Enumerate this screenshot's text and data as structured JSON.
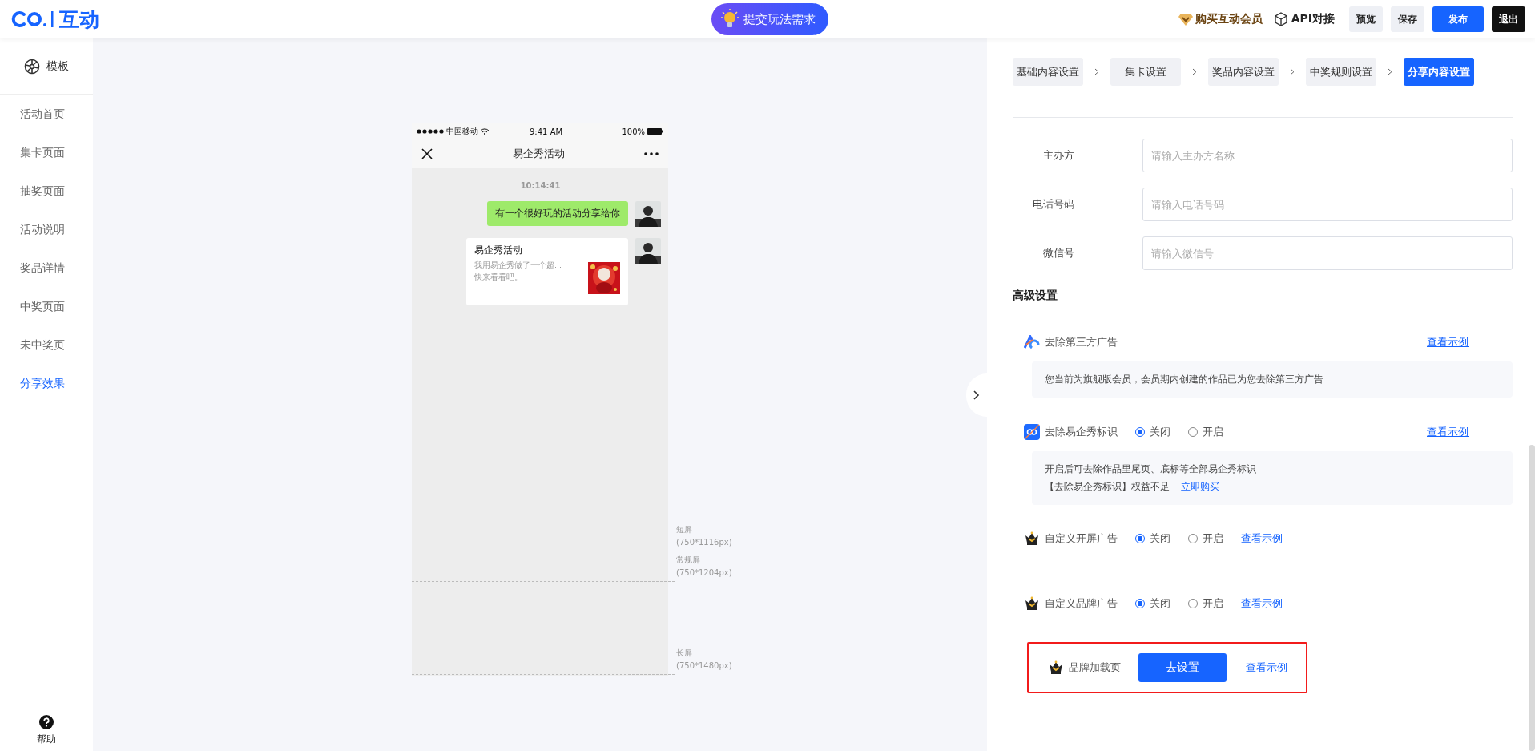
{
  "header": {
    "logo_text": "互动",
    "submit_button": "提交玩法需求",
    "member_link": "购买互动会员",
    "api_link": "API对接",
    "buttons": [
      {
        "label": "预览",
        "kind": "plain"
      },
      {
        "label": "保存",
        "kind": "plain"
      },
      {
        "label": "发布",
        "kind": "primary"
      },
      {
        "label": "退出",
        "kind": "dark"
      }
    ]
  },
  "sidebar": {
    "template": "模板",
    "items": [
      {
        "label": "活动首页",
        "selected": false
      },
      {
        "label": "集卡页面",
        "selected": false
      },
      {
        "label": "抽奖页面",
        "selected": false
      },
      {
        "label": "活动说明",
        "selected": false
      },
      {
        "label": "奖品详情",
        "selected": false
      },
      {
        "label": "中奖页面",
        "selected": false
      },
      {
        "label": "未中奖页",
        "selected": false
      },
      {
        "label": "分享效果",
        "selected": true
      }
    ],
    "help": "帮助"
  },
  "phone": {
    "carrier": "中国移动",
    "time": "9:41 AM",
    "battery": "100%",
    "title": "易企秀活动",
    "chat_time": "10:14:41",
    "message": "有一个很好玩的活动分享给你",
    "card": {
      "title": "易企秀活动",
      "lines": [
        "我用易企秀做了一个超...",
        "快来看看吧。"
      ]
    },
    "screen_marks": [
      {
        "label": "短屏",
        "size": "(750*1116px)"
      },
      {
        "label": "常规屏",
        "size": "(750*1204px)"
      },
      {
        "label": "长屏",
        "size": "(750*1480px)"
      }
    ]
  },
  "steps": [
    {
      "label": "基础内容设置",
      "selected": false
    },
    {
      "label": "集卡设置",
      "selected": false
    },
    {
      "label": "奖品内容设置",
      "selected": false
    },
    {
      "label": "中奖规则设置",
      "selected": false
    },
    {
      "label": "分享内容设置",
      "selected": true
    }
  ],
  "organizer_fields": [
    {
      "label": "主办方",
      "placeholder": "请输入主办方名称"
    },
    {
      "label": "电话号码",
      "placeholder": "请输入电话号码"
    },
    {
      "label": "微信号",
      "placeholder": "请输入微信号"
    }
  ],
  "advanced": {
    "title": "高级设置",
    "rows": [
      {
        "kind": "notice",
        "label": "去除第三方广告",
        "link": "查看示例",
        "note": [
          "您当前为旗舰版会员，会员期内创建的作品已为您去除第三方广告"
        ]
      },
      {
        "kind": "toggle",
        "label": "去除易企秀标识",
        "options": [
          {
            "label": "关闭",
            "selected": true
          },
          {
            "label": "开启",
            "selected": false
          }
        ],
        "link": "查看示例",
        "note": [
          "开启后可去除作品里尾页、底标等全部易企秀标识",
          "【去除易企秀标识】权益不足"
        ],
        "buy_link": "立即购买"
      },
      {
        "kind": "toggle",
        "label": "自定义开屏广告",
        "options": [
          {
            "label": "关闭",
            "selected": true
          },
          {
            "label": "开启",
            "selected": false
          }
        ],
        "link": "查看示例"
      },
      {
        "kind": "toggle",
        "label": "自定义品牌广告",
        "options": [
          {
            "label": "关闭",
            "selected": true
          },
          {
            "label": "开启",
            "selected": false
          }
        ],
        "link": "查看示例"
      },
      {
        "kind": "action",
        "label": "品牌加载页",
        "button": "去设置",
        "link": "查看示例",
        "highlighted": true
      }
    ]
  }
}
